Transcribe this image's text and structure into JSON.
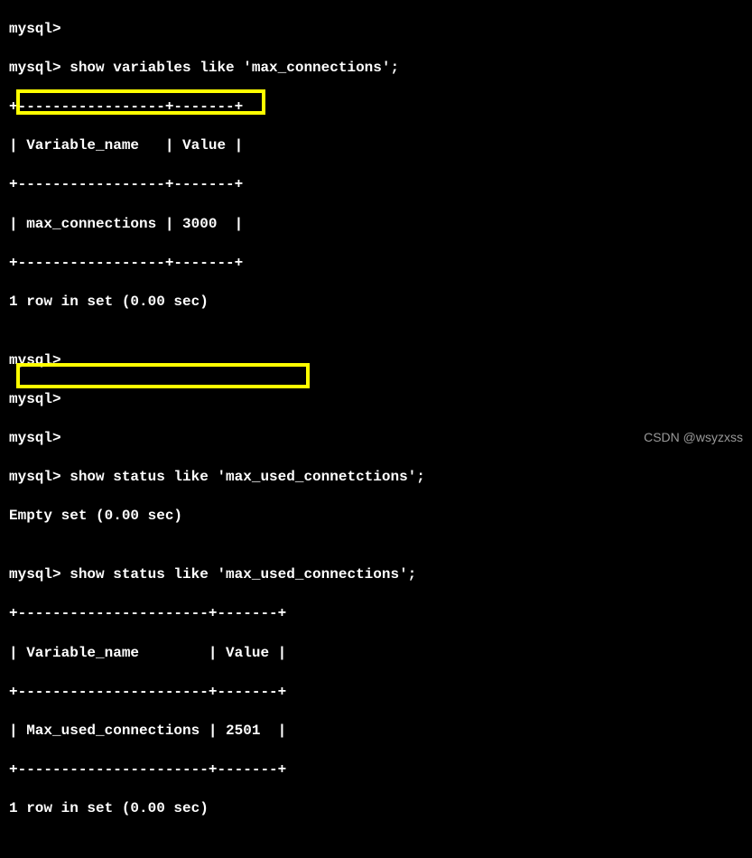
{
  "lines": {
    "l0": "mysql>",
    "l1": "mysql> show variables like 'max_connections';",
    "l2": "+-----------------+-------+",
    "l3": "| Variable_name   | Value |",
    "l4": "+-----------------+-------+",
    "l5": "| max_connections | 3000  |",
    "l6": "+-----------------+-------+",
    "l7": "1 row in set (0.00 sec)",
    "l8": "",
    "l9": "mysql>",
    "l10": "mysql>",
    "l11": "mysql>",
    "l12": "mysql> show status like 'max_used_connetctions';",
    "l13": "Empty set (0.00 sec)",
    "l14": "",
    "l15": "mysql> show status like 'max_used_connections';",
    "l16": "+----------------------+-------+",
    "l17": "| Variable_name        | Value |",
    "l18": "+----------------------+-------+",
    "l19": "| Max_used_connections | 2501  |",
    "l20": "+----------------------+-------+",
    "l21": "1 row in set (0.00 sec)",
    "l22": ""
  },
  "watermark": "CSDN @wsyzxss"
}
